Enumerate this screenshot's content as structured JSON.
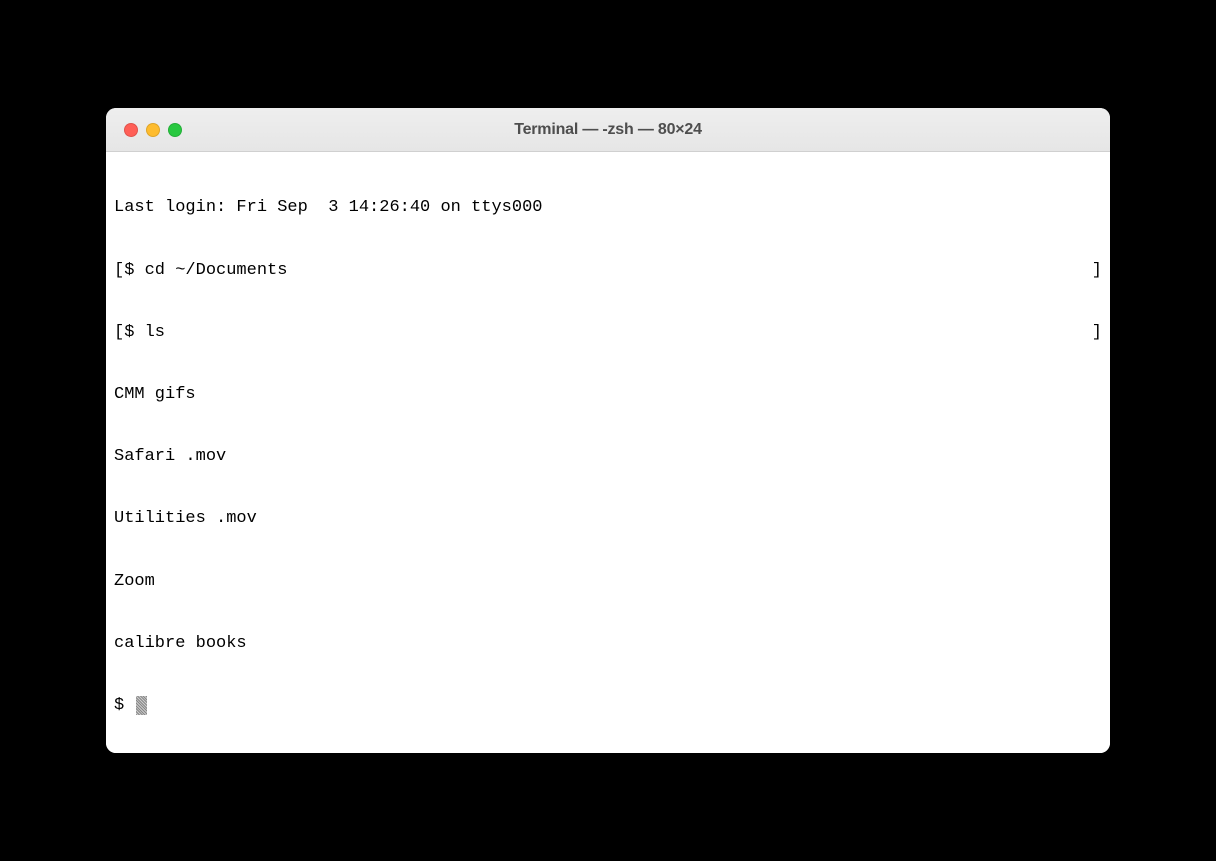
{
  "window": {
    "title": "Terminal — -zsh — 80×24"
  },
  "terminal": {
    "last_login": "Last login: Fri Sep  3 14:26:40 on ttys000",
    "prompt": "$ ",
    "open_bracket": "[",
    "close_bracket": "]",
    "commands": {
      "cd": "cd ~/Documents",
      "ls": "ls"
    },
    "output": {
      "line1": "CMM gifs",
      "line2": "Safari .mov",
      "line3": "Utilities .mov",
      "line4": "Zoom",
      "line5": "calibre books"
    }
  }
}
